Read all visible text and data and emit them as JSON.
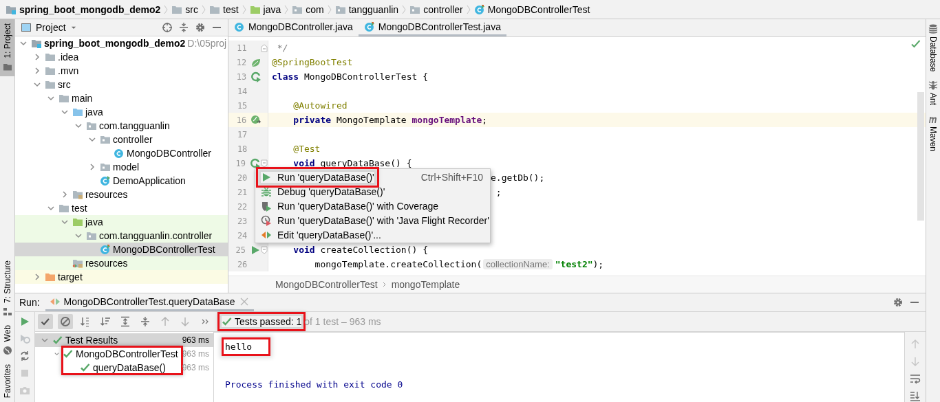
{
  "breadcrumbs": [
    {
      "label": "spring_boot_mongodb_demo2",
      "kind": "module"
    },
    {
      "label": "src",
      "kind": "folder"
    },
    {
      "label": "test",
      "kind": "folder"
    },
    {
      "label": "java",
      "kind": "test-folder"
    },
    {
      "label": "com",
      "kind": "package"
    },
    {
      "label": "tangguanlin",
      "kind": "package"
    },
    {
      "label": "controller",
      "kind": "package"
    },
    {
      "label": "MongoDBControllerTest",
      "kind": "test-class"
    }
  ],
  "left_tool_windows": {
    "top": [
      {
        "label": "1: Project",
        "kind": "project",
        "selected": true
      }
    ],
    "bottom": [
      {
        "label": "7: Structure",
        "kind": "structure",
        "selected": false
      },
      {
        "label": "Web",
        "kind": "web",
        "selected": false
      },
      {
        "label": "Favorites",
        "selected": false
      }
    ]
  },
  "right_tool_windows": [
    {
      "label": "Database",
      "kind": "database"
    },
    {
      "label": "Ant",
      "kind": "ant"
    },
    {
      "label": "Maven",
      "kind": "maven"
    }
  ],
  "project": {
    "title": "Project",
    "tree": [
      {
        "label": "spring_boot_mongodb_demo2",
        "hint": "D:\\05proj",
        "kind": "module",
        "expanded": true,
        "selected": false,
        "children": [
          {
            "label": ".idea",
            "kind": "folder",
            "expanded": false,
            "selected": false
          },
          {
            "label": ".mvn",
            "kind": "folder",
            "expanded": false,
            "selected": false
          },
          {
            "label": "src",
            "kind": "folder",
            "expanded": true,
            "selected": false,
            "children": [
              {
                "label": "main",
                "kind": "folder",
                "expanded": true,
                "selected": false,
                "children": [
                  {
                    "label": "java",
                    "kind": "source-folder",
                    "expanded": true,
                    "selected": false,
                    "children": [
                      {
                        "label": "com.tangguanlin",
                        "kind": "package",
                        "expanded": true,
                        "selected": false,
                        "children": [
                          {
                            "label": "controller",
                            "kind": "package",
                            "expanded": true,
                            "selected": false,
                            "children": [
                              {
                                "label": "MongoDBController",
                                "kind": "class",
                                "selected": false
                              }
                            ]
                          },
                          {
                            "label": "model",
                            "kind": "package",
                            "expanded": false,
                            "selected": false
                          },
                          {
                            "label": "DemoApplication",
                            "kind": "spring-class",
                            "selected": false
                          }
                        ]
                      }
                    ]
                  },
                  {
                    "label": "resources",
                    "kind": "resources",
                    "expanded": false,
                    "selected": false
                  }
                ]
              },
              {
                "label": "test",
                "kind": "folder",
                "expanded": true,
                "selected": false,
                "children": [
                  {
                    "label": "java",
                    "kind": "test-folder",
                    "expanded": true,
                    "selected": false,
                    "test_source": true,
                    "children": [
                      {
                        "label": "com.tangguanlin.controller",
                        "kind": "package",
                        "expanded": true,
                        "selected": false,
                        "test_source": true,
                        "children": [
                          {
                            "label": "MongoDBControllerTest",
                            "kind": "test-class",
                            "selected": true
                          }
                        ]
                      }
                    ]
                  },
                  {
                    "label": "resources",
                    "kind": "test-resources",
                    "selected": false,
                    "test_source": true
                  }
                ]
              }
            ]
          },
          {
            "label": "target",
            "kind": "excluded",
            "expanded": false,
            "selected": false,
            "excluded": true
          }
        ]
      }
    ]
  },
  "editor": {
    "tabs": [
      {
        "label": "MongoDBController.java",
        "kind": "class",
        "selected": false
      },
      {
        "label": "MongoDBControllerTest.java",
        "kind": "test-class",
        "selected": true
      }
    ],
    "lines": [
      {
        "number": "11",
        "fold": {
          "kind": "end"
        },
        "current": false,
        "tokens": [
          {
            "kind": "comment",
            "t": " */"
          }
        ]
      },
      {
        "number": "12",
        "gutter": {
          "kind": "spring"
        },
        "current": false,
        "tokens": [
          {
            "kind": "annotation",
            "t": "@SpringBootTest"
          }
        ]
      },
      {
        "number": "13",
        "gutter": {
          "kind": "run-test"
        },
        "current": false,
        "tokens": [
          {
            "kind": "keyword",
            "t": "class"
          },
          {
            "kind": "plain",
            "t": " MongoDBControllerTest {"
          }
        ]
      },
      {
        "number": "14",
        "current": false
      },
      {
        "number": "15",
        "current": false,
        "tokens": [
          {
            "kind": "annotation",
            "t": "    @Autowired"
          }
        ]
      },
      {
        "number": "16",
        "gutter": {
          "kind": "bean"
        },
        "current": true,
        "tokens": [
          {
            "kind": "keyword",
            "t": "    private"
          },
          {
            "kind": "plain",
            "t": " MongoTemplate "
          },
          {
            "kind": "field",
            "t": "mongoTemplate"
          },
          {
            "kind": "plain",
            "t": ";"
          }
        ]
      },
      {
        "number": "17",
        "current": false
      },
      {
        "number": "18",
        "current": false,
        "tokens": [
          {
            "kind": "annotation",
            "t": "    @Test"
          }
        ]
      },
      {
        "number": "19",
        "gutter": {
          "kind": "run-test"
        },
        "fold": {
          "kind": "start"
        },
        "current": false,
        "tokens": [
          {
            "kind": "keyword",
            "t": "    void"
          },
          {
            "kind": "plain",
            "t": " queryDataBase() {"
          }
        ]
      },
      {
        "number": "20",
        "current": false,
        "covered": true,
        "tokens": [
          {
            "kind": "plain",
            "t": "e.getDb();"
          }
        ]
      },
      {
        "number": "21",
        "current": false,
        "covered": true,
        "tokens": [
          {
            "kind": "plain",
            "t": " ;"
          }
        ]
      },
      {
        "number": "22",
        "current": false
      },
      {
        "number": "23",
        "current": false
      },
      {
        "number": "24",
        "current": false
      },
      {
        "number": "25",
        "gutter": {
          "kind": "run"
        },
        "fold": {
          "kind": "start"
        },
        "current": false,
        "tokens": [
          {
            "kind": "keyword",
            "t": "    void"
          },
          {
            "kind": "plain",
            "t": " createCollection() {"
          }
        ]
      },
      {
        "number": "26",
        "current": false,
        "tokens": [
          {
            "kind": "plain",
            "t": "        mongoTemplate.createCollection("
          },
          {
            "kind": "hint",
            "t": "collectionName:"
          },
          {
            "kind": "string",
            "t": "\"test2\""
          },
          {
            "kind": "plain",
            "t": ");"
          }
        ]
      }
    ],
    "context_menu": [
      {
        "kind": "run",
        "label": "Run 'queryDataBase()'",
        "shortcut": "Ctrl+Shift+F10",
        "highlighted": true
      },
      {
        "kind": "debug",
        "label": "Debug 'queryDataBase()'",
        "highlighted": false
      },
      {
        "kind": "coverage",
        "label": "Run 'queryDataBase()' with Coverage",
        "highlighted": false
      },
      {
        "kind": "jfr",
        "label": "Run 'queryDataBase()' with 'Java Flight Recorder'",
        "highlighted": false
      },
      {
        "kind": "edit",
        "label": "Edit 'queryDataBase()'...",
        "highlighted": false
      }
    ],
    "breadcrumbs": [
      "MongoDBControllerTest",
      "mongoTemplate"
    ]
  },
  "run": {
    "label": "Run:",
    "tab": {
      "label": "MongoDBControllerTest.queryDataBase",
      "selected": true
    },
    "side_tools": [
      {
        "kind": "rerun",
        "disabled": false
      },
      {
        "kind": "rerun-failed",
        "disabled": true
      },
      {
        "kind": "auto-test",
        "disabled": false
      },
      {
        "kind": "stop",
        "disabled": true
      },
      {
        "kind": "camera",
        "disabled": true
      }
    ],
    "toolbar": [
      {
        "kind": "show-passed",
        "on": true
      },
      {
        "kind": "show-ignored",
        "on": true
      },
      {
        "kind": "sort-alpha",
        "on": false
      },
      {
        "kind": "sort-duration",
        "on": false
      },
      {
        "kind": "expand-all",
        "on": false
      },
      {
        "kind": "collapse-all",
        "on": false
      },
      {
        "kind": "up",
        "on": false
      },
      {
        "kind": "down",
        "on": false
      },
      {
        "kind": "more",
        "on": false
      }
    ],
    "status": {
      "passed": "Tests passed: 1",
      "detail": "of 1 test – 963 ms",
      "highlighted": true
    },
    "results": [
      {
        "label": "Test Results",
        "time": "963 ms",
        "expanded": true,
        "selected": true,
        "highlighted": false,
        "children": [
          {
            "label": "MongoDBControllerTest",
            "time": "963 ms",
            "expanded": true,
            "selected": false,
            "highlighted": true,
            "children": [
              {
                "label": "queryDataBase()",
                "time": "963 ms",
                "selected": false,
                "highlighted": false
              }
            ]
          }
        ]
      }
    ],
    "console": [
      {
        "kind": "output",
        "text": "hello",
        "highlighted": true
      },
      {
        "kind": "system",
        "text": "Process finished with exit code 0",
        "highlighted": false
      }
    ],
    "console_tools": [
      {
        "kind": "up",
        "disabled": true
      },
      {
        "kind": "down",
        "disabled": true
      },
      {
        "kind": "wrap",
        "disabled": false
      },
      {
        "kind": "scroll-end",
        "disabled": false
      }
    ]
  }
}
